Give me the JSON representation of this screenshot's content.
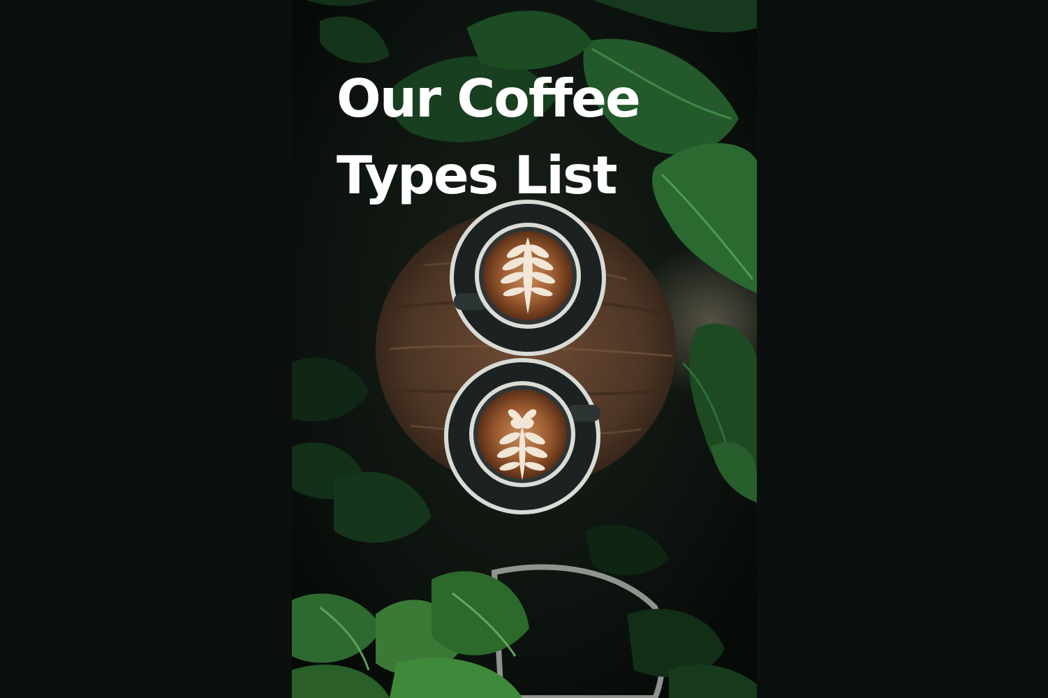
{
  "title": {
    "line1": "Our Coffee",
    "line2": "Types List"
  },
  "palette": {
    "background": "#0b0f0e",
    "title_text": "#ffffff",
    "leaf_green": "#2f6e34",
    "wood": "#6a4a34",
    "saucer": "#1e2424",
    "crema": "#8a4f2a"
  },
  "photo": {
    "subject": "two latte art coffee cups on wooden stool surrounded by plants"
  }
}
